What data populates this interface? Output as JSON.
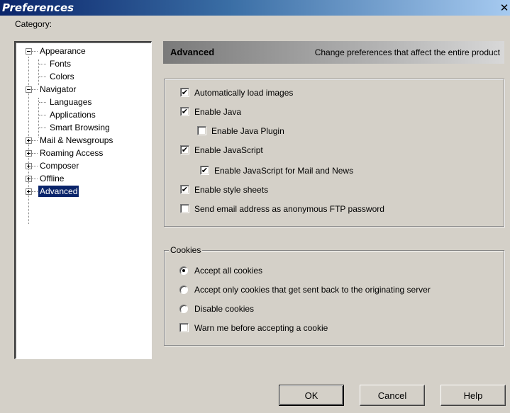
{
  "window": {
    "title": "Preferences",
    "close_glyph": "✕"
  },
  "category_label": "Category:",
  "tree": {
    "items": [
      {
        "label": "Appearance",
        "level": 0,
        "expander": "minus"
      },
      {
        "label": "Fonts",
        "level": 1
      },
      {
        "label": "Colors",
        "level": 1
      },
      {
        "label": "Navigator",
        "level": 0,
        "expander": "minus"
      },
      {
        "label": "Languages",
        "level": 1
      },
      {
        "label": "Applications",
        "level": 1
      },
      {
        "label": "Smart Browsing",
        "level": 1
      },
      {
        "label": "Mail & Newsgroups",
        "level": 0,
        "expander": "plus"
      },
      {
        "label": "Roaming Access",
        "level": 0,
        "expander": "plus"
      },
      {
        "label": "Composer",
        "level": 0,
        "expander": "plus"
      },
      {
        "label": "Offline",
        "level": 0,
        "expander": "plus"
      },
      {
        "label": "Advanced",
        "level": 0,
        "expander": "plus",
        "selected": true
      }
    ]
  },
  "header": {
    "title": "Advanced",
    "description": "Change preferences that affect the entire product"
  },
  "options": [
    {
      "label": "Automatically load images",
      "checked": true
    },
    {
      "label": "Enable Java",
      "checked": true
    },
    {
      "label": "Enable Java Plugin",
      "checked": false
    },
    {
      "label": "Enable JavaScript",
      "checked": true
    },
    {
      "label": "Enable JavaScript for Mail and News",
      "checked": true
    },
    {
      "label": "Enable style sheets",
      "checked": true
    },
    {
      "label": "Send email address as anonymous FTP password",
      "checked": false
    }
  ],
  "cookies": {
    "legend": "Cookies",
    "radios": [
      {
        "label": "Accept all cookies",
        "selected": true
      },
      {
        "label": "Accept only cookies that get sent back to the originating server",
        "selected": false
      },
      {
        "label": "Disable cookies",
        "selected": false
      }
    ],
    "warn": {
      "label": "Warn me before accepting a cookie",
      "checked": false
    }
  },
  "buttons": {
    "ok": "OK",
    "cancel": "Cancel",
    "help": "Help"
  },
  "check_glyph": "✔"
}
